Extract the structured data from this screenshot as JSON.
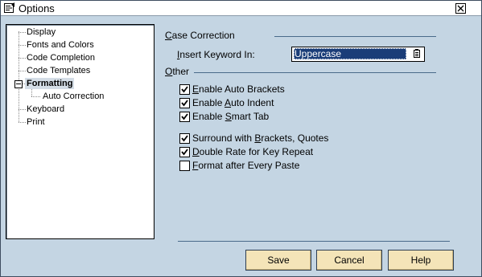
{
  "window": {
    "title": "Options",
    "icon": "options-dialog-icon",
    "close_icon": "close-icon"
  },
  "tree": {
    "items": [
      {
        "label": "Display",
        "icon": "tree-connector"
      },
      {
        "label": "Fonts and Colors",
        "icon": "tree-connector"
      },
      {
        "label": "Code Completion",
        "icon": "tree-connector"
      },
      {
        "label": "Code Templates",
        "icon": "tree-connector"
      },
      {
        "label": "Formatting",
        "icon": "collapse-minus-icon",
        "selected": true,
        "expanded": true
      },
      {
        "label": "Auto Correction",
        "icon": "tree-connector",
        "child": true
      },
      {
        "label": "Keyboard",
        "icon": "tree-connector"
      },
      {
        "label": "Print",
        "icon": "tree-connector"
      }
    ]
  },
  "case_correction": {
    "heading_prefix": "",
    "heading_accel": "C",
    "heading_rest": "ase Correction",
    "insert_label_accel": "I",
    "insert_label_rest": "nsert Keyword In:",
    "insert_value": "Uppercase",
    "dropdown_icon": "dropdown-list-icon"
  },
  "other": {
    "heading_accel": "O",
    "heading_rest": "ther",
    "options": [
      {
        "pre": "",
        "accel": "E",
        "post": "nable Auto Brackets",
        "checked": true
      },
      {
        "pre": "Enable ",
        "accel": "A",
        "post": "uto Indent",
        "checked": true
      },
      {
        "pre": "Enable ",
        "accel": "S",
        "post": "mart Tab",
        "checked": true
      },
      {
        "pre": "Surround with ",
        "accel": "B",
        "post": "rackets, Quotes",
        "checked": true
      },
      {
        "pre": "",
        "accel": "D",
        "post": "ouble Rate for Key Repeat",
        "checked": true
      },
      {
        "pre": "",
        "accel": "F",
        "post": "ormat after Every Paste",
        "checked": false
      }
    ]
  },
  "buttons": {
    "save": "Save",
    "cancel": "Cancel",
    "help": "Help"
  },
  "colors": {
    "dialog_bg": "#c4d5e3",
    "button_bg": "#f4e4b8",
    "selection": "#1a3d78"
  }
}
